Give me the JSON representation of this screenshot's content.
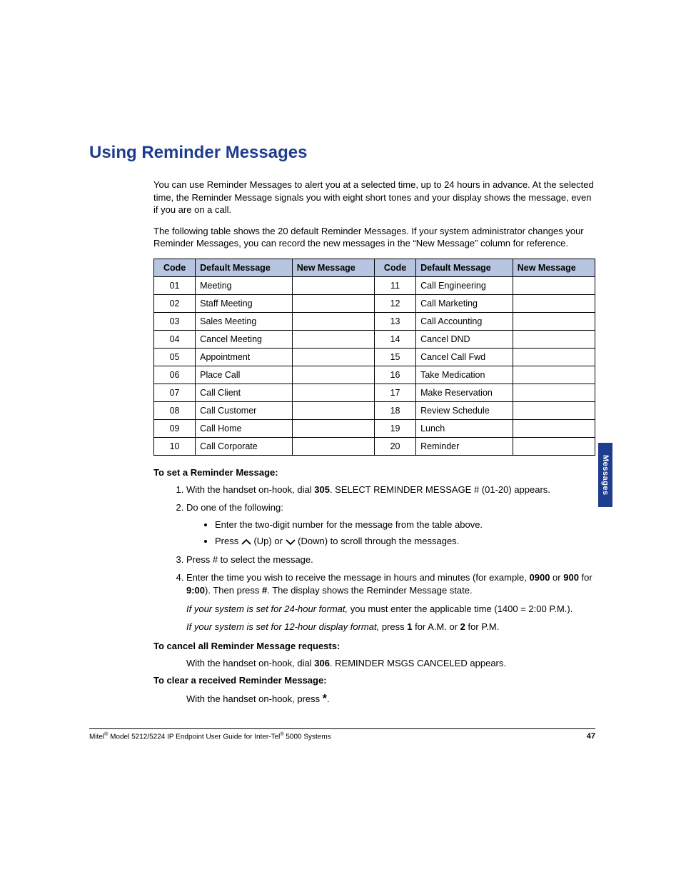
{
  "heading": "Using Reminder Messages",
  "para1": "You can use Reminder Messages to alert you at a selected time, up to 24 hours in advance. At the selected time, the Reminder Message signals you with eight short tones and your display shows the message, even if you are on a call.",
  "para2": "The following table shows the 20 default Reminder Messages. If your system administrator changes your Reminder Messages, you can record the new messages in the “New Message” column for reference.",
  "table_headers": [
    "Code",
    "Default Message",
    "New Message",
    "Code",
    "Default Message",
    "New Message"
  ],
  "table_rows": [
    [
      "01",
      "Meeting",
      "",
      "11",
      "Call Engineering",
      ""
    ],
    [
      "02",
      "Staff Meeting",
      "",
      "12",
      "Call Marketing",
      ""
    ],
    [
      "03",
      "Sales Meeting",
      "",
      "13",
      "Call Accounting",
      ""
    ],
    [
      "04",
      "Cancel Meeting",
      "",
      "14",
      "Cancel DND",
      ""
    ],
    [
      "05",
      "Appointment",
      "",
      "15",
      "Cancel Call Fwd",
      ""
    ],
    [
      "06",
      "Place Call",
      "",
      "16",
      "Take Medication",
      ""
    ],
    [
      "07",
      "Call Client",
      "",
      "17",
      "Make Reservation",
      ""
    ],
    [
      "08",
      "Call Customer",
      "",
      "18",
      "Review Schedule",
      ""
    ],
    [
      "09",
      "Call Home",
      "",
      "19",
      "Lunch",
      ""
    ],
    [
      "10",
      "Call Corporate",
      "",
      "20",
      "Reminder",
      ""
    ]
  ],
  "set_title": "To set a Reminder Message:",
  "step1_a": "With the handset on-hook, dial ",
  "step1_b": "305",
  "step1_c": ". SELECT REMINDER MESSAGE # (01-20) appears.",
  "step2": "Do one of the following:",
  "step2_b1": "Enter the two-digit number for the message from the table above.",
  "step2_b2_a": "Press ",
  "step2_b2_b": " (Up) or ",
  "step2_b2_c": " (Down) to scroll through the messages.",
  "step3": "Press # to select the message.",
  "step4_a": "Enter the time you wish to receive the message in hours and minutes (for example, ",
  "step4_b": "0900",
  "step4_c": " or ",
  "step4_d": "900",
  "step4_e": " for ",
  "step4_f": "9:00",
  "step4_g": "). Then press ",
  "step4_h": "#",
  "step4_i": ". The display shows the Reminder Message state.",
  "note24_a": "If your system is set for 24-hour format,",
  "note24_b": " you must enter the applicable time (1400 = 2:00 P.M.).",
  "note12_a": "If your system is set for 12-hour display format,",
  "note12_b": " press ",
  "note12_c": "1",
  "note12_d": " for A.M. or ",
  "note12_e": "2",
  "note12_f": " for P.M.",
  "cancel_title": "To cancel all Reminder Message requests:",
  "cancel_a": "With the handset on-hook, dial ",
  "cancel_b": "306",
  "cancel_c": ". REMINDER MSGS CANCELED appears.",
  "clear_title": "To clear a received Reminder Message:",
  "clear_a": "With the handset on-hook, press ",
  "clear_b": "*",
  "clear_c": ".",
  "footer_text": "Mitel® Model 5212/5224 IP Endpoint User Guide for Inter-Tel® 5000 Systems",
  "page_number": "47",
  "side_tab": "Messages"
}
